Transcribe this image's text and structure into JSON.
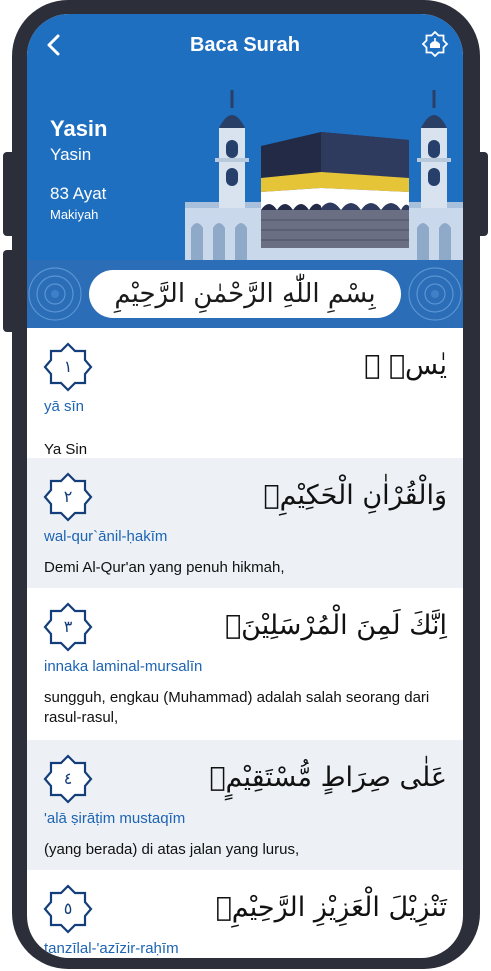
{
  "header": {
    "title": "Baca Surah",
    "surah_name": "Yasin",
    "surah_latin": "Yasin",
    "ayat_count": "83 Ayat",
    "revelation": "Makiyah"
  },
  "bismillah": "بِسْمِ اللّٰهِ الرَّحْمٰنِ الرَّحِيْمِ",
  "verses": [
    {
      "number": "١",
      "arabic": "يٰسۤ ۚ",
      "latin": "yā sīn",
      "translation": "Ya Sin"
    },
    {
      "number": "٢",
      "arabic": "وَالْقُرْاٰنِ الْحَكِيْمِۙ",
      "latin": "wal-qur`ānil-ḥakīm",
      "translation": "Demi Al-Qur'an yang penuh hikmah,"
    },
    {
      "number": "٣",
      "arabic": "اِنَّكَ لَمِنَ الْمُرْسَلِيْنَۙ",
      "latin": "innaka laminal-mursalīn",
      "translation": "sungguh, engkau (Muhammad) adalah salah seorang dari rasul-rasul,"
    },
    {
      "number": "٤",
      "arabic": "عَلٰى صِرَاطٍ مُّسْتَقِيْمٍۗ",
      "latin": "'alā ṣirāṭim mustaqīm",
      "translation": "(yang berada) di atas jalan yang lurus,"
    },
    {
      "number": "٥",
      "arabic": "تَنْزِيْلَ الْعَزِيْزِ الرَّحِيْمِۙ",
      "latin": "tanzīlal-'azīzir-raḥīm",
      "translation": ""
    }
  ],
  "colors": {
    "primary": "#1e6fc0",
    "alt_row": "#edf1f5",
    "latin_text": "#1d64b3",
    "frame": "#2c2e3a"
  },
  "icons": {
    "back": "chevron-left-icon",
    "menu": "mosque-badge-icon",
    "verse_marker": "star-octagon-icon"
  }
}
